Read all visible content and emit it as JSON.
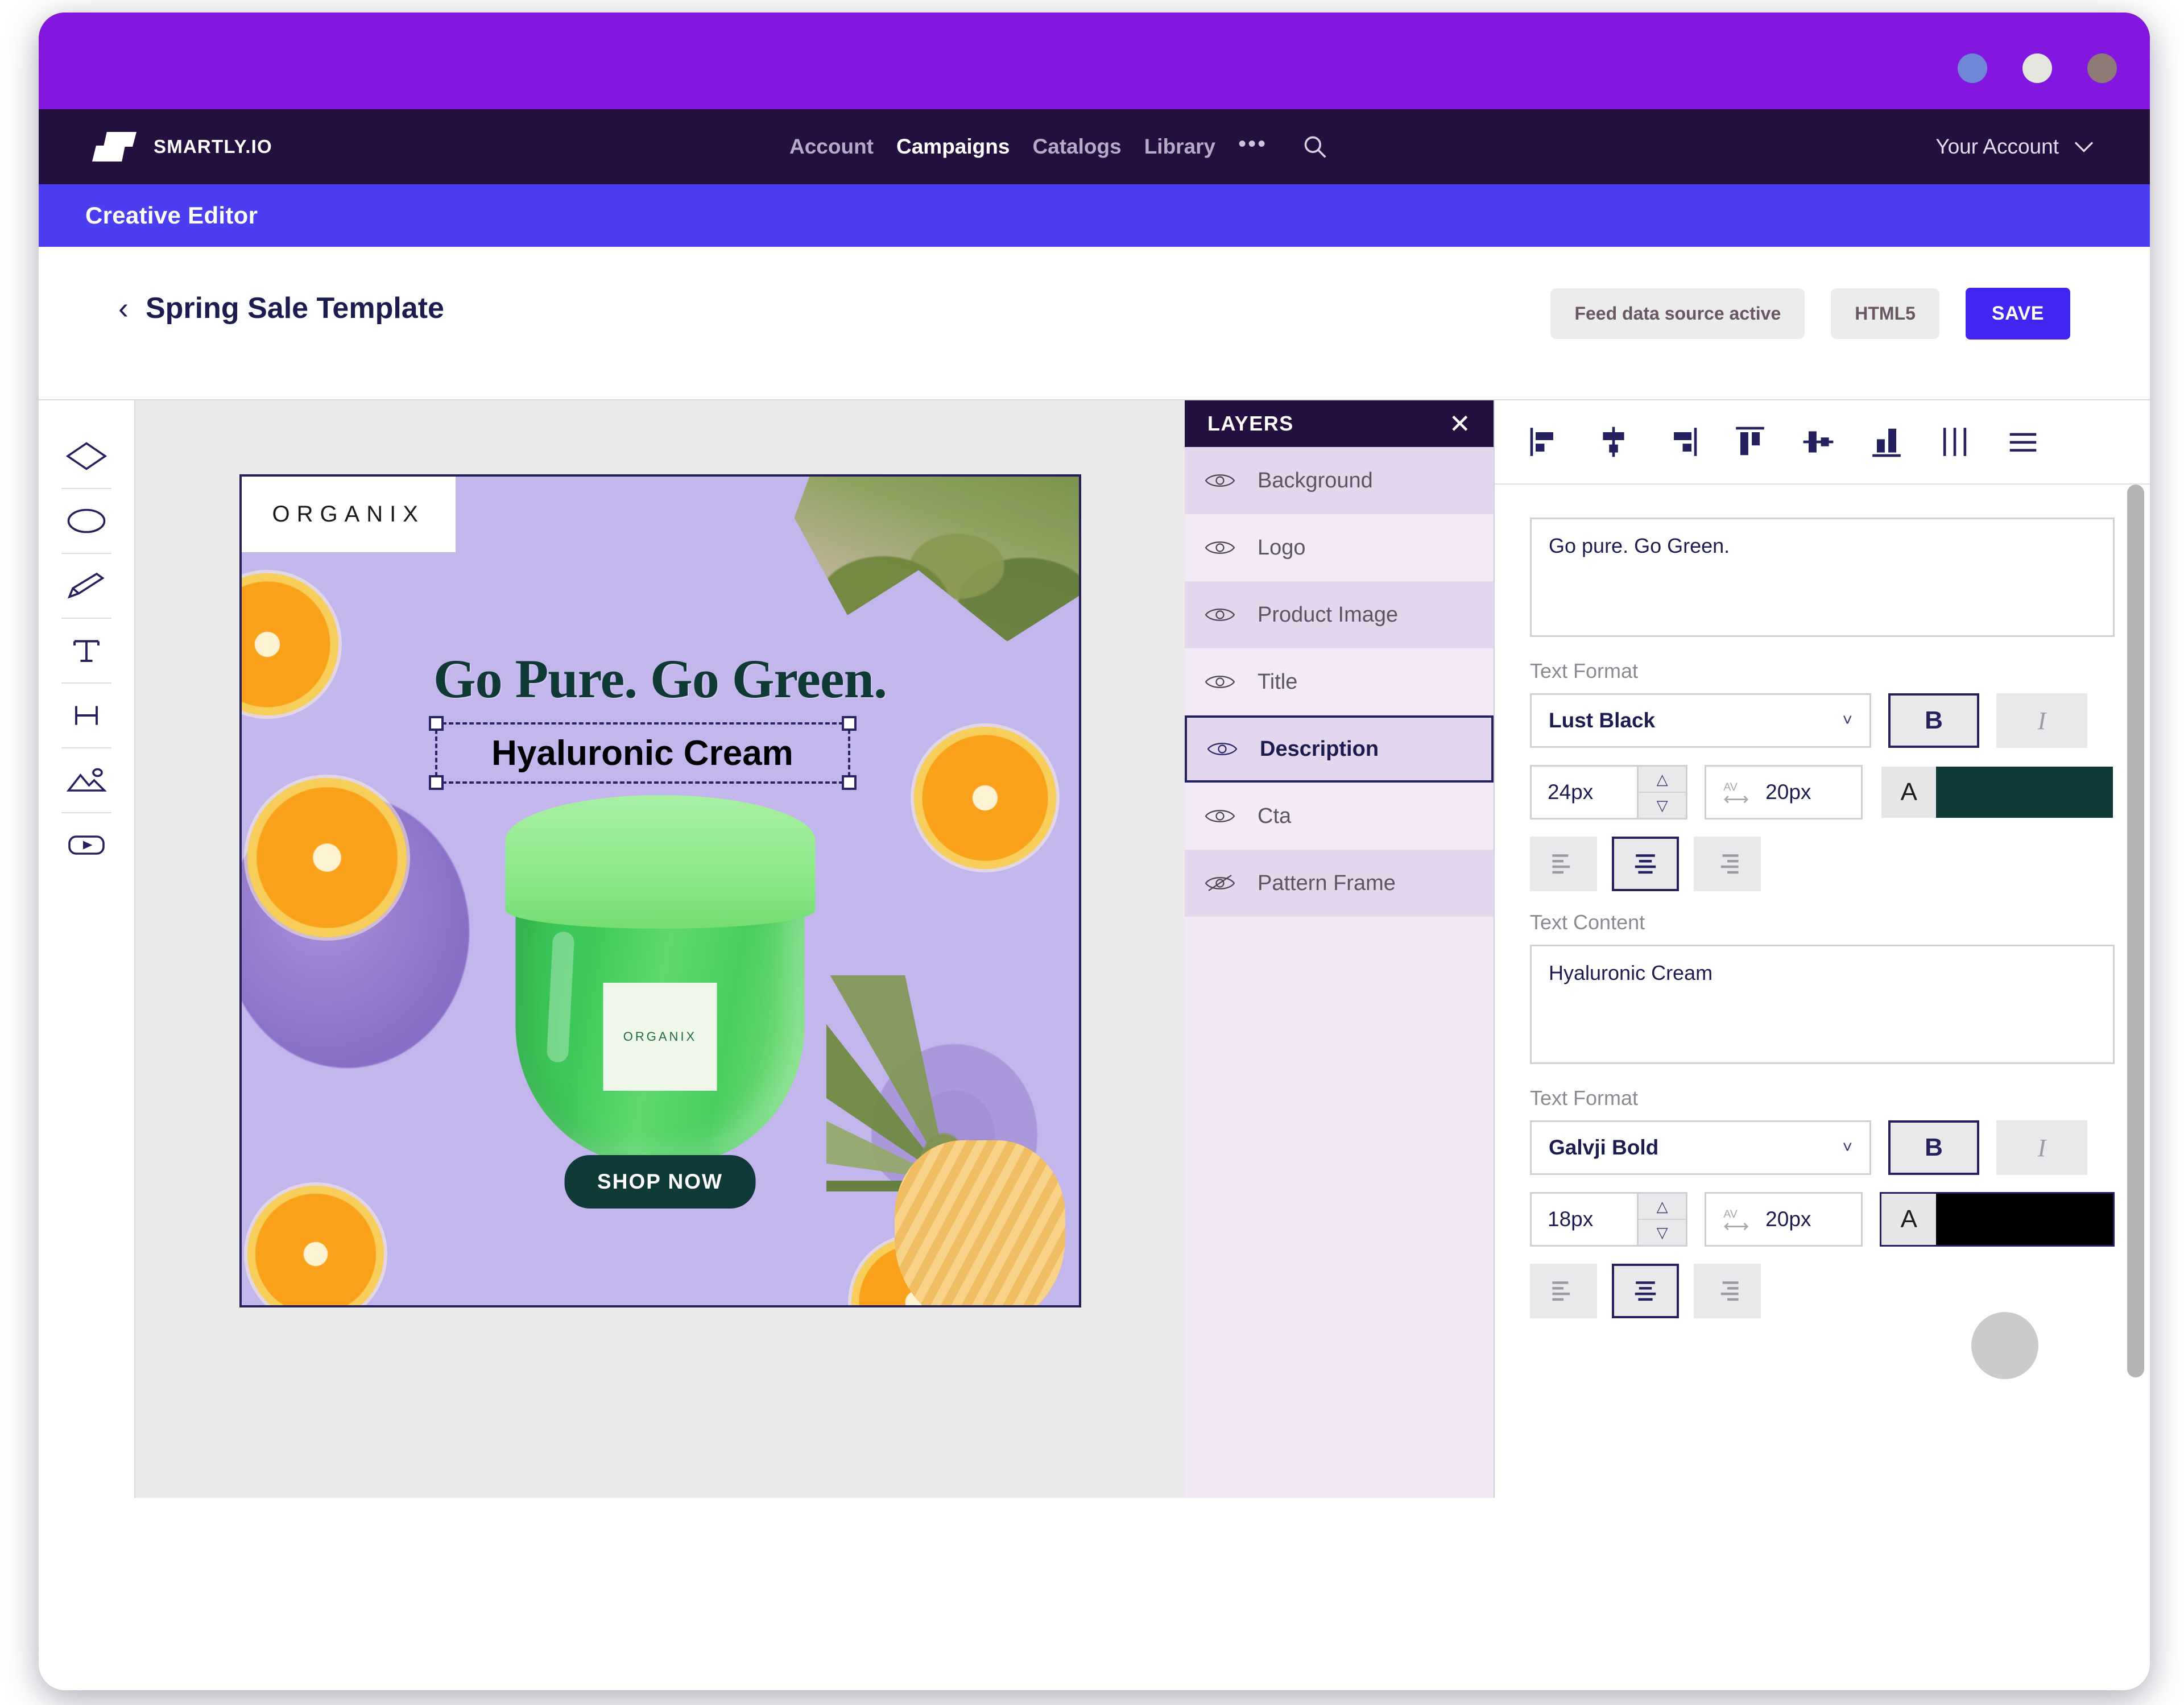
{
  "window": {
    "traffic_lights": [
      "window-dot-blue",
      "window-dot-white",
      "window-dot-brown"
    ]
  },
  "navbar": {
    "brand": "SMARTLY.IO",
    "links": [
      {
        "label": "Account",
        "active": false
      },
      {
        "label": "Campaigns",
        "active": true
      },
      {
        "label": "Catalogs",
        "active": false
      },
      {
        "label": "Library",
        "active": false
      }
    ],
    "overflow": "•••",
    "search_icon": "search-icon",
    "account": "Your Account",
    "account_chevron": "chevron-down-icon"
  },
  "editor_band": {
    "title": "Creative Editor"
  },
  "subheader": {
    "back_chevron": "‹",
    "template_name": "Spring Sale Template",
    "feed_pill": "Feed data source active",
    "format_pill": "HTML5",
    "save_label": "SAVE"
  },
  "tool_rail": {
    "tools": [
      {
        "name": "shape-diamond-icon"
      },
      {
        "name": "shape-circle-icon"
      },
      {
        "name": "pencil-icon"
      },
      {
        "name": "text-icon"
      },
      {
        "name": "heading-icon"
      },
      {
        "name": "image-icon"
      },
      {
        "name": "video-icon"
      }
    ]
  },
  "canvas": {
    "logo_text": "ORGANIX",
    "headline": "Go Pure. Go Green.",
    "subtitle": "Hyaluronic Cream",
    "jar_label": "ORGANIX",
    "cta": "SHOP NOW",
    "background_color": "#c3b6ec",
    "headline_color": "#0e3a33",
    "cta_bg": "#0f3a38"
  },
  "layers": {
    "title": "LAYERS",
    "close_icon": "close-icon",
    "items": [
      {
        "label": "Background",
        "visible": true,
        "selected": false
      },
      {
        "label": "Logo",
        "visible": true,
        "selected": false
      },
      {
        "label": "Product Image",
        "visible": true,
        "selected": false
      },
      {
        "label": "Title",
        "visible": true,
        "selected": false
      },
      {
        "label": "Description",
        "visible": true,
        "selected": true
      },
      {
        "label": "Cta",
        "visible": true,
        "selected": false
      },
      {
        "label": "Pattern Frame",
        "visible": false,
        "selected": false
      }
    ]
  },
  "align_toolbar": {
    "buttons": [
      {
        "name": "align-left-icon"
      },
      {
        "name": "align-center-horizontal-icon"
      },
      {
        "name": "align-right-icon"
      },
      {
        "name": "align-top-icon"
      },
      {
        "name": "align-middle-vertical-icon"
      },
      {
        "name": "align-bottom-icon"
      },
      {
        "name": "distribute-horizontal-icon"
      },
      {
        "name": "menu-icon"
      }
    ]
  },
  "properties": {
    "title_section": {
      "text_value": "Go pure. Go Green.",
      "format_label": "Text Format",
      "font": "Lust Black",
      "bold_label": "B",
      "italic_label": "I",
      "bold_active": true,
      "italic_active": false,
      "size": "24px",
      "kerning": "20px",
      "kerning_icon_label": "AV",
      "color_glyph": "A",
      "color": "#0f3a38",
      "alignment": "center"
    },
    "description_section": {
      "content_label": "Text Content",
      "text_value": "Hyaluronic Cream",
      "format_label": "Text Format",
      "font": "Galvji Bold",
      "bold_label": "B",
      "italic_label": "I",
      "bold_active": true,
      "italic_active": false,
      "size": "18px",
      "kerning": "20px",
      "kerning_icon_label": "AV",
      "color_glyph": "A",
      "color": "#000000",
      "alignment": "center"
    }
  }
}
